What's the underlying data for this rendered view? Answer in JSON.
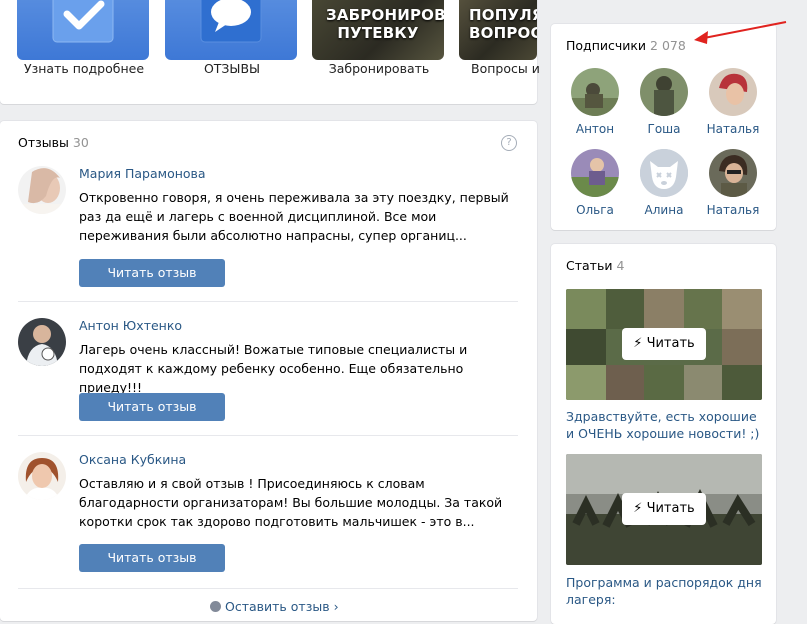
{
  "menu": {
    "items": [
      {
        "label": "Узнать подробнее",
        "tile_text": ""
      },
      {
        "label": "ОТЗЫВЫ",
        "tile_text": ""
      },
      {
        "label": "Забронировать",
        "tile_text": "ЗАБРОНИРОВАТЬ ПУТЕВКУ"
      },
      {
        "label": "Вопросы и",
        "tile_text": "ПОПУЛЯ ВОПРОС"
      }
    ]
  },
  "reviews": {
    "title": "Отзывы",
    "count": "30",
    "help": "?",
    "items": [
      {
        "name": "Мария Парамонова",
        "text": "Откровенно говоря, я очень переживала за эту поездку, первый раз да ещё и лагерь с военной дисциплиной. Все мои переживания были абсолютно напрасны, супер органиц...",
        "button": "Читать отзыв"
      },
      {
        "name": "Антон Юхтенко",
        "text": "Лагерь очень классный! Вожатые типовые специалисты и подходят к каждому ребенку особенно. Еще обязательно приеду!!!",
        "button": "Читать отзыв"
      },
      {
        "name": "Оксана Кубкина",
        "text": "Оставляю и я свой отзыв ! Присоединяюсь к словам благодарности организаторам! Вы большие молодцы. За такой коротки срок так здорово подготовить мальчишек - это в...",
        "button": "Читать отзыв"
      }
    ],
    "leave_link": "Оставить отзыв"
  },
  "subscribers": {
    "title": "Подписчики",
    "count": "2 078",
    "items": [
      {
        "name": "Антон"
      },
      {
        "name": "Гоша"
      },
      {
        "name": "Наталья"
      },
      {
        "name": "Ольга"
      },
      {
        "name": "Алина"
      },
      {
        "name": "Наталья"
      }
    ]
  },
  "articles": {
    "title": "Статьи",
    "count": "4",
    "items": [
      {
        "read_label": "Читать",
        "title": "Здравствуйте, есть хорошие и ОЧЕНЬ хорошие новости! ;)"
      },
      {
        "read_label": "Читать",
        "title": "Программа и распорядок дня лагеря:"
      }
    ]
  },
  "colors": {
    "link": "#2a5885",
    "button": "#5181b8",
    "background": "#edeef0",
    "arrow": "#e0231f"
  }
}
